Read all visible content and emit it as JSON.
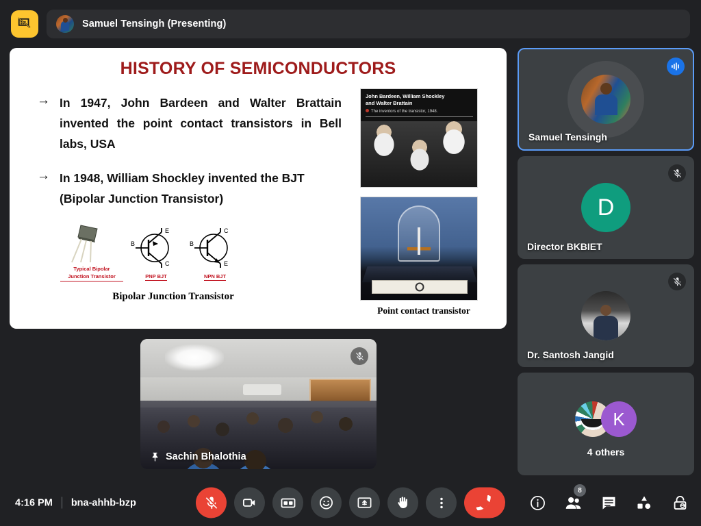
{
  "topbar": {
    "present_icon": "stop-presenting-icon",
    "presenter_label": "Samuel Tensingh (Presenting)"
  },
  "slide": {
    "title": "HISTORY OF SEMICONDUCTORS",
    "bullets": [
      "In 1947, John Bardeen and Walter Brattain invented the point contact transistors in Bell labs, USA",
      "In 1948, William Shockley invented the BJT (Bipolar Junction Transistor)"
    ],
    "bullet_marker": "→",
    "figure": {
      "typical_label_line1": "Typical Bipolar",
      "typical_label_line2": "Junction Transistor",
      "pnp_label": "PNP BJT",
      "npn_label": "NPN BJT",
      "terminal_b": "B",
      "terminal_c": "C",
      "terminal_e": "E",
      "caption": "Bipolar Junction Transistor"
    },
    "photo_historical": {
      "caption_line1": "John Bardeen, William Shockley",
      "caption_line2": "and Walter Brattain",
      "subcaption": "The inventors of the transistor, 1948."
    },
    "photo_point_contact": {
      "caption": "Point contact transistor"
    }
  },
  "selfview": {
    "name": "Sachin Bhalothia",
    "pin_icon": "pin-icon",
    "mic_icon": "mic-off-icon"
  },
  "participants": [
    {
      "name": "Samuel Tensingh",
      "avatar_type": "photo",
      "active_speaker": true,
      "badge_icon": "audio-active-icon",
      "badge_color": "#1A73E8"
    },
    {
      "name": "Director BKBIET",
      "avatar_type": "initial",
      "initial": "D",
      "avatar_color": "#0F9D7E",
      "active_speaker": false,
      "badge_icon": "mic-off-icon"
    },
    {
      "name": "Dr. Santosh Jangid",
      "avatar_type": "photo",
      "active_speaker": false,
      "badge_icon": "mic-off-icon"
    },
    {
      "name": "4 others",
      "avatar_type": "group",
      "group_initial": "K",
      "group_color": "#9B59D0",
      "active_speaker": false,
      "badge_icon": ""
    }
  ],
  "bottombar": {
    "time": "4:16 PM",
    "meeting_code": "bna-ahhb-bzp",
    "controls": [
      {
        "name": "microphone-toggle",
        "icon": "mic-off-icon",
        "state": "muted",
        "color": "#EA4335"
      },
      {
        "name": "camera-toggle",
        "icon": "camera-icon",
        "state": "on",
        "color": "#3C4043"
      },
      {
        "name": "captions-toggle",
        "icon": "closed-captions-icon",
        "state": "off",
        "color": "#3C4043"
      },
      {
        "name": "reactions-button",
        "icon": "emoji-icon",
        "state": "off",
        "color": "#3C4043"
      },
      {
        "name": "present-now-button",
        "icon": "present-screen-icon",
        "state": "off",
        "color": "#3C4043"
      },
      {
        "name": "raise-hand-button",
        "icon": "raised-hand-icon",
        "state": "off",
        "color": "#3C4043"
      },
      {
        "name": "more-options-button",
        "icon": "more-vertical-icon",
        "state": "off",
        "color": "#3C4043"
      },
      {
        "name": "leave-call-button",
        "icon": "end-call-icon",
        "state": "on",
        "color": "#EA4335"
      }
    ],
    "right_icons": [
      {
        "name": "meeting-details-button",
        "icon": "info-icon",
        "badge": ""
      },
      {
        "name": "participants-button",
        "icon": "people-icon",
        "badge": "8"
      },
      {
        "name": "chat-button",
        "icon": "chat-icon",
        "badge": ""
      },
      {
        "name": "activities-button",
        "icon": "activities-shapes-icon",
        "badge": ""
      },
      {
        "name": "host-controls-button",
        "icon": "lock-shield-icon",
        "badge": ""
      }
    ]
  },
  "colors": {
    "app_background": "#202124",
    "tile_background": "#3C4043",
    "accent_blue": "#5B9CF8",
    "danger_red": "#EA4335",
    "present_yellow": "#FDC52F",
    "slide_title_red": "#9E1B1B"
  }
}
